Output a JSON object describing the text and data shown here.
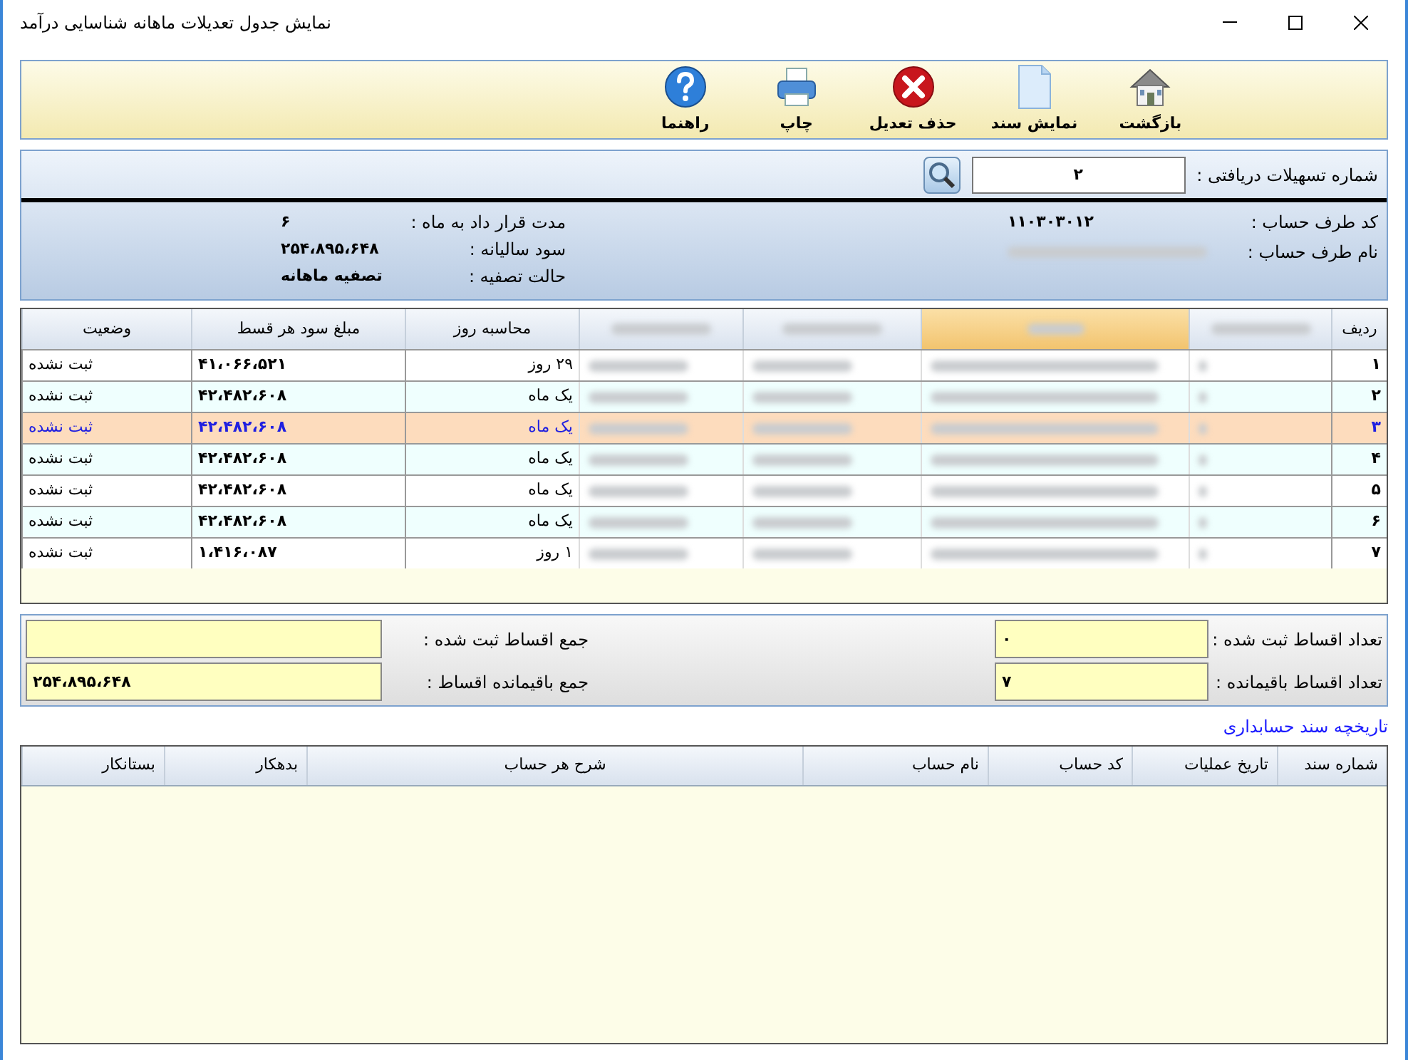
{
  "window": {
    "title": "نمایش جدول تعدیلات ماهانه شناسایی درآمد"
  },
  "toolbar": [
    {
      "kind": "home",
      "label": "بازگشت"
    },
    {
      "kind": "document",
      "label": "نمایش سند"
    },
    {
      "kind": "delete",
      "label": "حذف تعدیل"
    },
    {
      "kind": "print",
      "label": "چاپ"
    },
    {
      "kind": "help",
      "label": "راهنما"
    }
  ],
  "search": {
    "label": "شماره تسهیلات دریافتی :",
    "value": "۲"
  },
  "info_right": [
    {
      "label": "کد طرف حساب :",
      "value": "۱۱۰۳۰۳۰۱۲",
      "kind": "text"
    },
    {
      "label": "نام طرف حساب :",
      "kind": "blurred"
    }
  ],
  "info_left": [
    {
      "label": "مدت قرار داد به ماه :",
      "value": "۶"
    },
    {
      "label": "سود سالیانه :",
      "value": "۲۵۴،۸۹۵،۶۴۸"
    },
    {
      "label": "حالت تصفیه :",
      "value": "تصفیه ماهانه"
    }
  ],
  "table": {
    "columns": [
      {
        "kind": "row_no",
        "label": "ردیف",
        "selected": false
      },
      {
        "kind": "blurred",
        "selected": false
      },
      {
        "kind": "blurred",
        "selected": true
      },
      {
        "kind": "blurred",
        "selected": false
      },
      {
        "kind": "blurred",
        "selected": false
      },
      {
        "kind": "days",
        "label": "محاسبه روز",
        "selected": false
      },
      {
        "kind": "amount",
        "label": "مبلغ سود هر قسط",
        "selected": false
      },
      {
        "kind": "status",
        "label": "وضعیت",
        "selected": false
      }
    ],
    "rows": [
      {
        "row_no": "۱",
        "days": "۲۹ روز",
        "amount": "۴۱،۰۶۶،۵۲۱",
        "status": "ثبت نشده",
        "selected": false
      },
      {
        "row_no": "۲",
        "days": "یک ماه",
        "amount": "۴۲،۴۸۲،۶۰۸",
        "status": "ثبت نشده",
        "selected": false
      },
      {
        "row_no": "۳",
        "days": "یک ماه",
        "amount": "۴۲،۴۸۲،۶۰۸",
        "status": "ثبت نشده",
        "selected": true
      },
      {
        "row_no": "۴",
        "days": "یک ماه",
        "amount": "۴۲،۴۸۲،۶۰۸",
        "status": "ثبت نشده",
        "selected": false
      },
      {
        "row_no": "۵",
        "days": "یک ماه",
        "amount": "۴۲،۴۸۲،۶۰۸",
        "status": "ثبت نشده",
        "selected": false
      },
      {
        "row_no": "۶",
        "days": "یک ماه",
        "amount": "۴۲،۴۸۲،۶۰۸",
        "status": "ثبت نشده",
        "selected": false
      },
      {
        "row_no": "۷",
        "days": "۱ روز",
        "amount": "۱،۴۱۶،۰۸۷",
        "status": "ثبت نشده",
        "selected": false
      }
    ]
  },
  "totals": {
    "right": [
      {
        "label": "تعداد اقساط ثبت شده :",
        "value": "۰"
      },
      {
        "label": "تعداد اقساط باقیمانده :",
        "value": "۷"
      }
    ],
    "left": [
      {
        "label": "جمع اقساط ثبت شده :"
      },
      {
        "label": "جمع باقیمانده اقساط :",
        "value": "۲۵۴،۸۹۵،۶۴۸"
      }
    ]
  },
  "history_link": "تاریخچه سند حسابداری",
  "history_table": {
    "columns": [
      "شماره سند",
      "تاریخ عملیات",
      "کد حساب",
      "نام حساب",
      "شرح هر حساب",
      "بدهکار",
      "بستانکار"
    ]
  }
}
